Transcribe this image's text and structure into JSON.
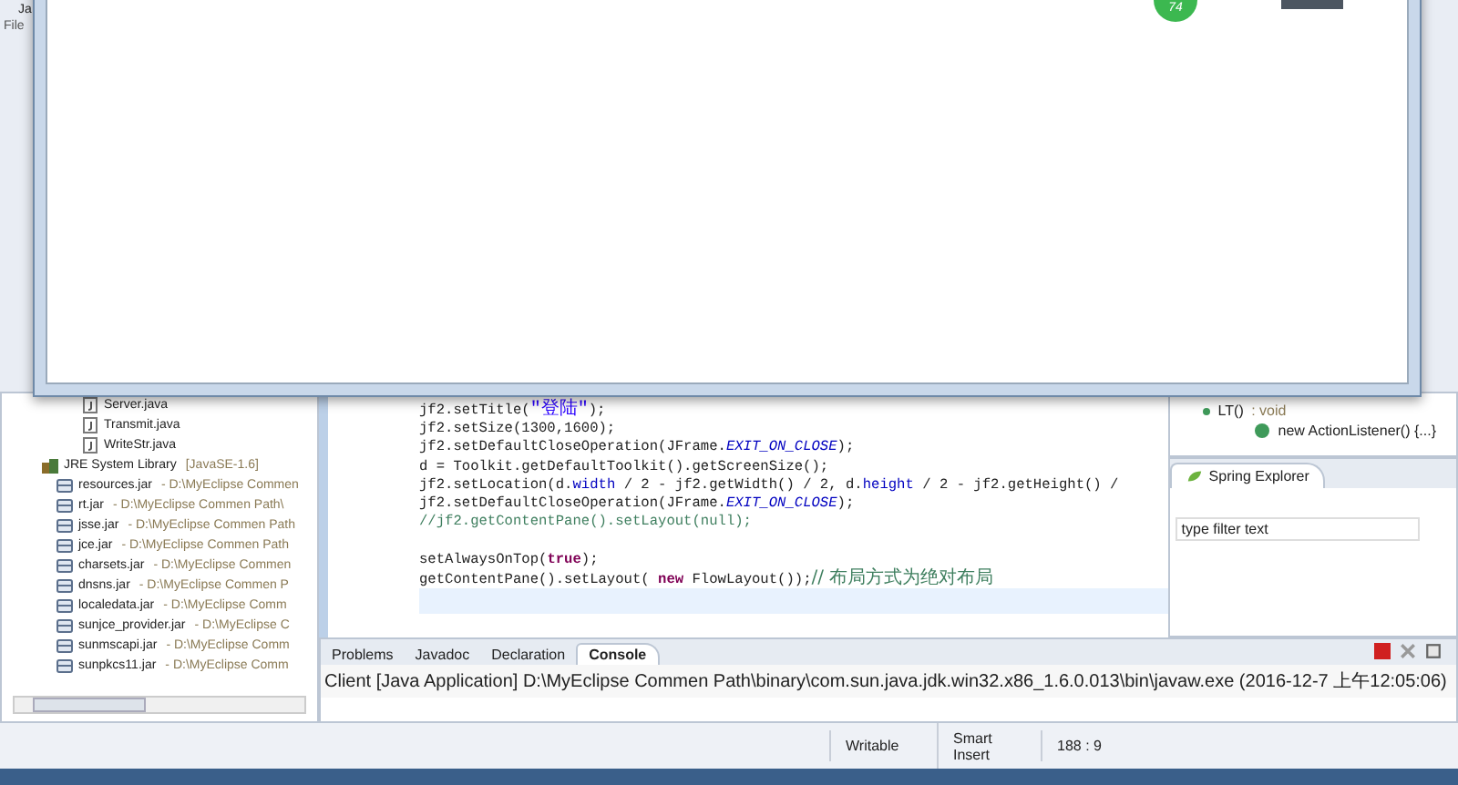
{
  "window": {
    "app_letters": "Ja"
  },
  "menu": [
    "File"
  ],
  "overlay_window": {
    "badge": "74"
  },
  "package_explorer": {
    "items": [
      {
        "label": "Server.java",
        "kind": "java-file"
      },
      {
        "label": "Transmit.java",
        "kind": "java-file"
      },
      {
        "label": "WriteStr.java",
        "kind": "java-file"
      },
      {
        "label": "JRE System Library",
        "detail": "[JavaSE-1.6]",
        "kind": "library",
        "children": [
          {
            "label": "resources.jar",
            "detail": "- D:\\MyEclipse Commen",
            "kind": "jar"
          },
          {
            "label": "rt.jar",
            "detail": "- D:\\MyEclipse Commen Path\\",
            "kind": "jar"
          },
          {
            "label": "jsse.jar",
            "detail": "- D:\\MyEclipse Commen Path",
            "kind": "jar"
          },
          {
            "label": "jce.jar",
            "detail": "- D:\\MyEclipse Commen Path",
            "kind": "jar"
          },
          {
            "label": "charsets.jar",
            "detail": "- D:\\MyEclipse Commen",
            "kind": "jar"
          },
          {
            "label": "dnsns.jar",
            "detail": "- D:\\MyEclipse Commen P",
            "kind": "jar"
          },
          {
            "label": "localedata.jar",
            "detail": "- D:\\MyEclipse Comm",
            "kind": "jar"
          },
          {
            "label": "sunjce_provider.jar",
            "detail": "- D:\\MyEclipse C",
            "kind": "jar"
          },
          {
            "label": "sunmscapi.jar",
            "detail": "- D:\\MyEclipse Comm",
            "kind": "jar"
          },
          {
            "label": "sunpkcs11.jar",
            "detail": "- D:\\MyEclipse Comm",
            "kind": "jar"
          }
        ]
      }
    ]
  },
  "editor": {
    "lines": [
      {
        "kind": "code",
        "segments": [
          {
            "text": "jf2.setTitle(",
            "kind": "plain"
          },
          {
            "text": "\"登陆\"",
            "kind": "string"
          },
          {
            "text": ");",
            "kind": "plain"
          }
        ]
      },
      {
        "kind": "code",
        "segments": [
          {
            "text": "jf2.setSize(1300,1600);",
            "kind": "plain"
          }
        ]
      },
      {
        "kind": "code",
        "segments": [
          {
            "text": "jf2.setDefaultCloseOperation(JFrame.",
            "kind": "plain"
          },
          {
            "text": "EXIT_ON_CLOSE",
            "kind": "constant"
          },
          {
            "text": ");",
            "kind": "plain"
          }
        ]
      },
      {
        "kind": "code",
        "segments": [
          {
            "text": "d = Toolkit.getDefaultToolkit().getScreenSize();",
            "kind": "plain"
          }
        ]
      },
      {
        "kind": "code",
        "segments": [
          {
            "text": "jf2.setLocation(d.",
            "kind": "plain"
          },
          {
            "text": "width",
            "kind": "field"
          },
          {
            "text": " / 2 - jf2.getWidth() / 2, d.",
            "kind": "plain"
          },
          {
            "text": "height",
            "kind": "field"
          },
          {
            "text": " / 2 - jf2.getHeight() /",
            "kind": "plain"
          }
        ]
      },
      {
        "kind": "code",
        "segments": [
          {
            "text": "jf2.setDefaultCloseOperation(JFrame.",
            "kind": "plain"
          },
          {
            "text": "EXIT_ON_CLOSE",
            "kind": "constant"
          },
          {
            "text": ");",
            "kind": "plain"
          }
        ]
      },
      {
        "kind": "code",
        "segments": [
          {
            "text": "//jf2.getContentPane().setLayout(null);",
            "kind": "comment"
          }
        ]
      },
      {
        "kind": "blank"
      },
      {
        "kind": "code",
        "segments": [
          {
            "text": "setAlwaysOnTop(",
            "kind": "plain"
          },
          {
            "text": "true",
            "kind": "keyword"
          },
          {
            "text": ");",
            "kind": "plain"
          }
        ]
      },
      {
        "kind": "code",
        "segments": [
          {
            "text": "getContentPane().setLayout( ",
            "kind": "plain"
          },
          {
            "text": "new",
            "kind": "keyword"
          },
          {
            "text": " FlowLayout());",
            "kind": "plain"
          },
          {
            "text": "// 布局方式为绝对布局",
            "kind": "cjk-comment"
          }
        ]
      },
      {
        "kind": "current"
      }
    ]
  },
  "outline": {
    "items": [
      {
        "label": "LT()",
        "detail": " : void",
        "kind": "method"
      },
      {
        "label": "new ActionListener() {...}",
        "kind": "anonymous"
      }
    ]
  },
  "spring_explorer": {
    "tab": "Spring Explorer",
    "filter": {
      "placeholder": "type filter text"
    }
  },
  "console": {
    "tabs": [
      {
        "label": "Problems",
        "selected": false
      },
      {
        "label": "Javadoc",
        "selected": false
      },
      {
        "label": "Declaration",
        "selected": false
      },
      {
        "label": "Console",
        "selected": true
      }
    ],
    "text": "Client [Java Application] D:\\MyEclipse Commen Path\\binary\\com.sun.java.jdk.win32.x86_1.6.0.013\\bin\\javaw.exe (2016-12-7 上午12:05:06)"
  },
  "status_bar": [
    "Writable",
    "Smart Insert",
    "188 : 9"
  ]
}
